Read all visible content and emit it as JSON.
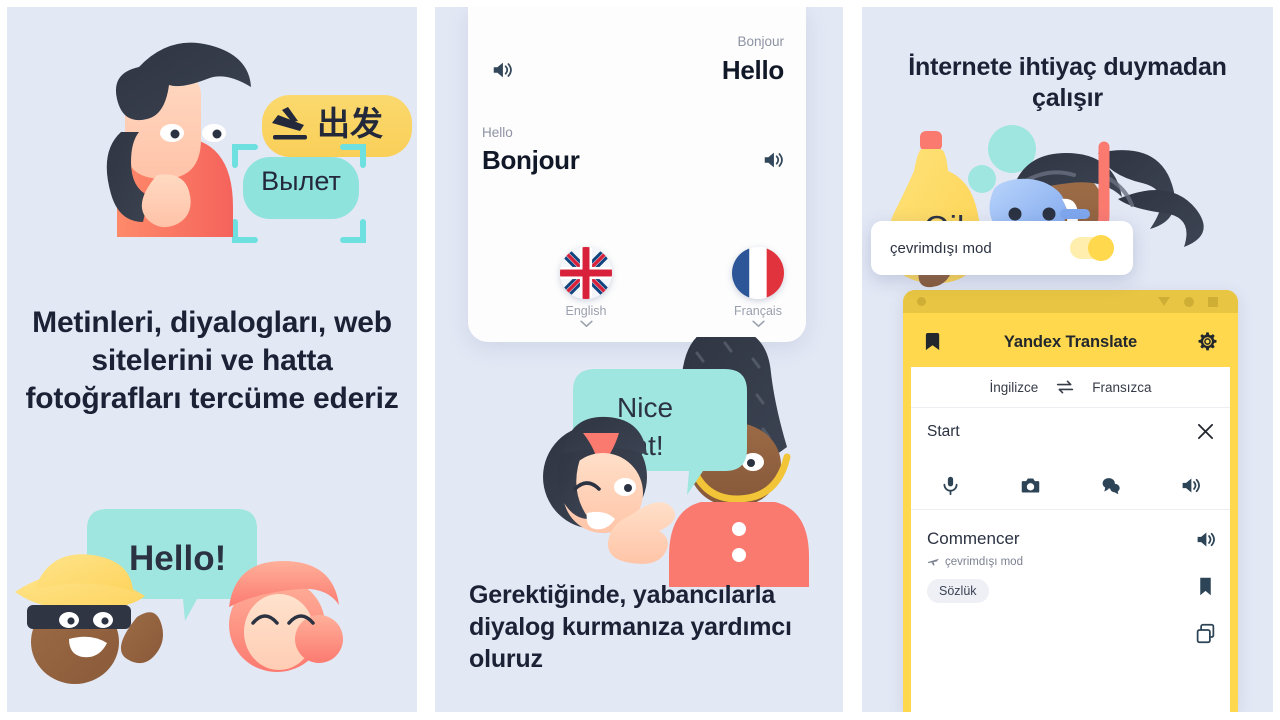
{
  "theme": {
    "panel_bg": "#e3e8f5",
    "page_bg": "#ffffff",
    "text_dark": "#1b2235",
    "accent_yellow": "#ffd84d",
    "accent_teal": "#9fe6e0",
    "accent_coral": "#fd7764"
  },
  "panels": [
    {
      "id": "panel-1",
      "headline": "Metinleri, diyalogları, web sitelerini ve hatta fotoğrafları tercüme ederiz",
      "illustration": {
        "name": "man-scanning-sign",
        "bubble_yellow_text": "出发",
        "bubble_yellow_icon": "airplane-departure-icon",
        "bubble_teal_text": "Вылет",
        "scan_frame": true
      },
      "bottom_illustration": {
        "name": "two-people-greeting",
        "bubble_text": "Hello!"
      }
    },
    {
      "id": "panel-2",
      "headline": "Gerektiğinde, yabancılarla diyalog kurmanıza yardımcı oluruz",
      "card": {
        "row_top": {
          "source": "Bonjour",
          "target": "Hello",
          "speaker_icon": "speaker-icon"
        },
        "row_bottom": {
          "source": "Hello",
          "target": "Bonjour",
          "speaker_icon": "speaker-icon"
        },
        "languages": [
          {
            "label": "English",
            "flag": "uk-flag",
            "chevron": "chevron-down-icon"
          },
          {
            "label": "Français",
            "flag": "france-flag",
            "chevron": "chevron-down-icon"
          }
        ]
      },
      "illustration": {
        "name": "girl-and-guard",
        "bubble_line1": "Nice",
        "bubble_line2": "hat!"
      }
    },
    {
      "id": "panel-3",
      "headline": "İnternete ihtiyaç duymadan çalışır",
      "illustration": {
        "name": "diver-with-oil-bottle",
        "bottle_label": "Oil"
      },
      "app": {
        "window_title": "Yandex Translate",
        "bookmark_icon": "bookmark-icon",
        "gear_icon": "gear-icon",
        "window_controls": [
          "dot",
          "triangle-down",
          "circle",
          "square"
        ],
        "lang_from": "İngilizce",
        "lang_to": "Fransızca",
        "swap_icon": "swap-arrows-icon",
        "input_value": "Start",
        "clear_icon": "close-icon",
        "tools": [
          "microphone-icon",
          "camera-icon",
          "dialog-icon",
          "speaker-icon"
        ],
        "toast": {
          "label": "çevrimdışı mod",
          "toggle_on": true
        },
        "result": {
          "word": "Commencer",
          "sub_icon": "airplane-icon",
          "sub_label": "çevrimdışı mod",
          "chip": "Sözlük",
          "side_icons": [
            "speaker-icon",
            "bookmark-icon",
            "copy-icon"
          ]
        }
      }
    }
  ]
}
